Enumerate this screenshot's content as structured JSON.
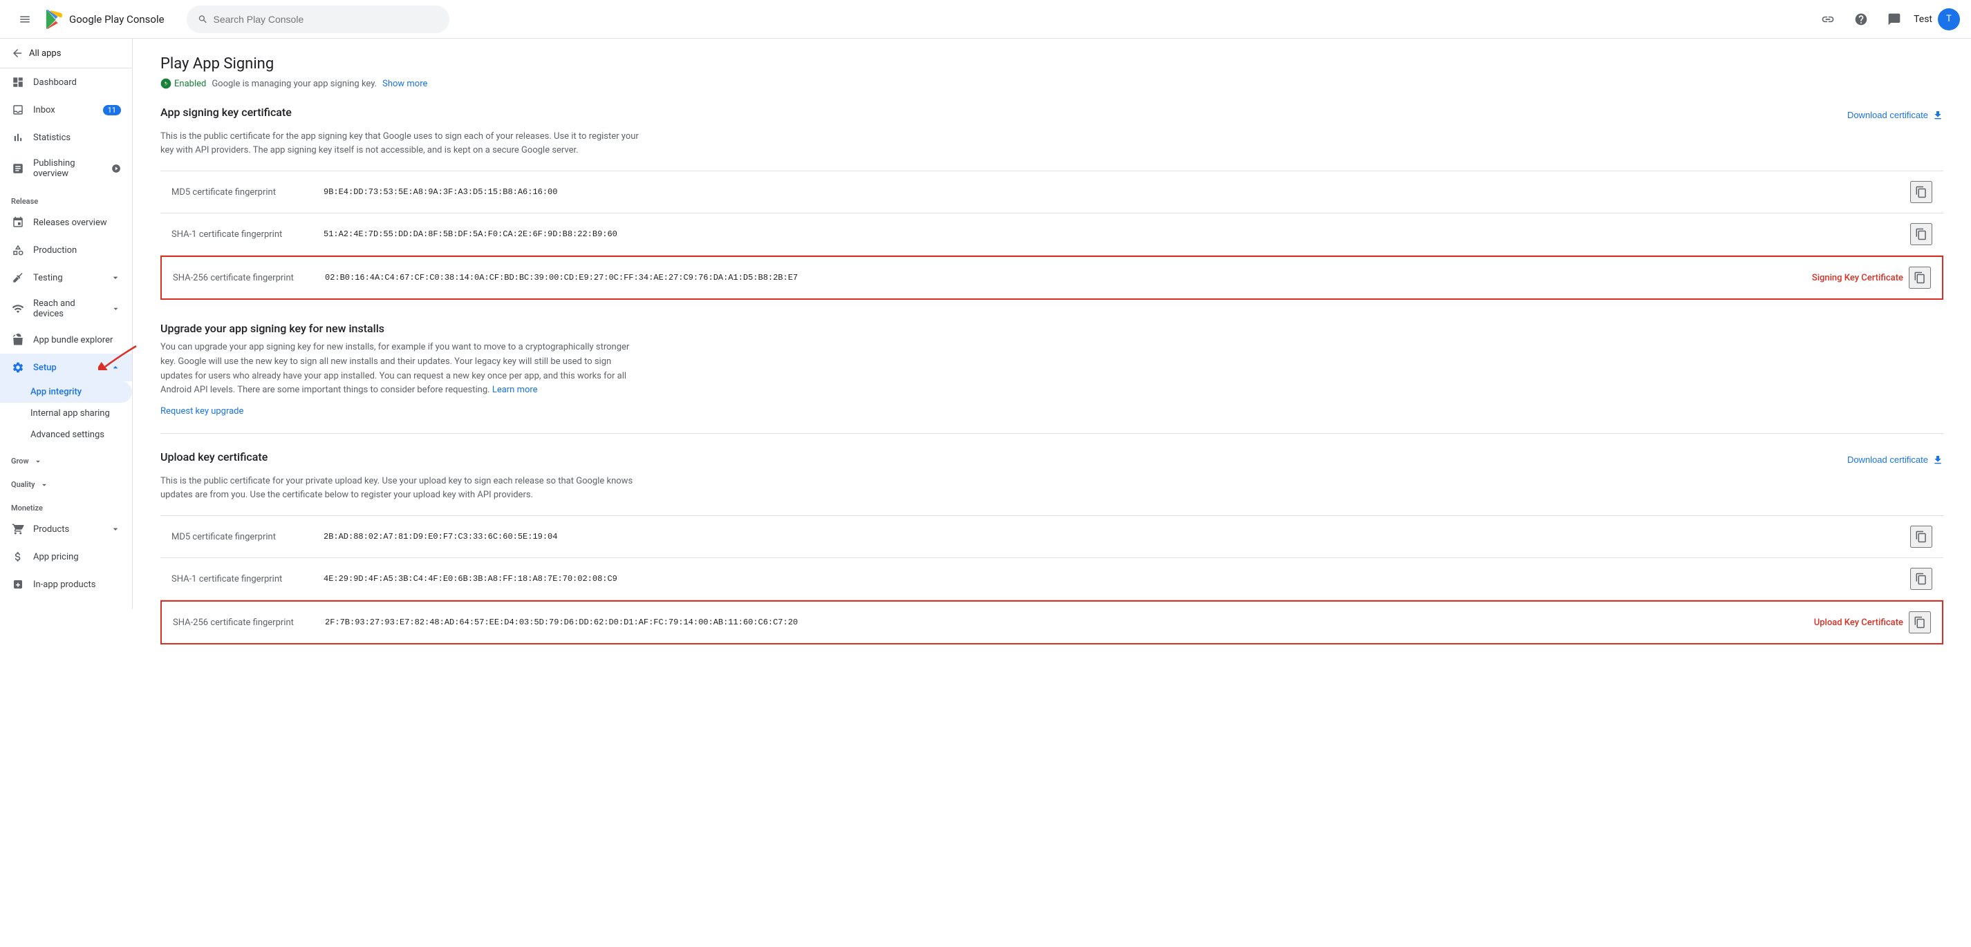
{
  "header": {
    "menu_label": "Menu",
    "logo_text": "Google Play Console",
    "search_placeholder": "Search Play Console",
    "help_label": "Help",
    "messages_label": "Messages",
    "link_label": "Link",
    "user_name": "Test"
  },
  "sidebar": {
    "all_apps_label": "All apps",
    "nav_items": [
      {
        "id": "dashboard",
        "label": "Dashboard",
        "icon": "dashboard"
      },
      {
        "id": "inbox",
        "label": "Inbox",
        "icon": "inbox",
        "badge": "11"
      },
      {
        "id": "statistics",
        "label": "Statistics",
        "icon": "statistics"
      },
      {
        "id": "publishing_overview",
        "label": "Publishing overview",
        "icon": "publishing"
      }
    ],
    "release_section": "Release",
    "release_items": [
      {
        "id": "releases_overview",
        "label": "Releases overview",
        "icon": "releases"
      },
      {
        "id": "production",
        "label": "Production",
        "icon": "production"
      },
      {
        "id": "testing",
        "label": "Testing",
        "icon": "testing",
        "expandable": true
      },
      {
        "id": "reach_devices",
        "label": "Reach and devices",
        "icon": "reach",
        "expandable": true
      },
      {
        "id": "app_bundle",
        "label": "App bundle explorer",
        "icon": "bundle"
      },
      {
        "id": "setup",
        "label": "Setup",
        "icon": "setup",
        "expandable": true,
        "active": true
      }
    ],
    "setup_sub_items": [
      {
        "id": "app_integrity",
        "label": "App integrity",
        "active": true
      },
      {
        "id": "internal_sharing",
        "label": "Internal app sharing"
      },
      {
        "id": "advanced_settings",
        "label": "Advanced settings"
      }
    ],
    "grow_section": "Grow",
    "quality_section": "Quality",
    "monetize_section": "Monetize",
    "monetize_items": [
      {
        "id": "products",
        "label": "Products",
        "expandable": true
      },
      {
        "id": "app_pricing",
        "label": "App pricing"
      },
      {
        "id": "in_app_products",
        "label": "In-app products"
      }
    ]
  },
  "page": {
    "title": "Play App Signing",
    "status_label": "Enabled",
    "status_description": "Google is managing your app signing key.",
    "show_more_label": "Show more",
    "app_signing_key_section": {
      "title": "App signing key certificate",
      "description": "This is the public certificate for the app signing key that Google uses to sign each of your releases. Use it to register your key with API providers. The app signing key itself is not accessible, and is kept on a secure Google server.",
      "download_label": "Download certificate",
      "rows": [
        {
          "label": "MD5 certificate fingerprint",
          "value": "9B:E4:DD:73:53:5E:A8:9A:3F:A3:D5:15:B8:A6:16:00",
          "highlighted": false
        },
        {
          "label": "SHA-1 certificate fingerprint",
          "value": "51:A2:4E:7D:55:DD:DA:8F:5B:DF:5A:F0:CA:2E:6F:9D:B8:22:B9:60",
          "highlighted": false
        },
        {
          "label": "SHA-256 certificate fingerprint",
          "value": "02:B0:16:4A:C4:67:CF:C0:38:14:0A:CF:BD:BC:39:00:CD:E9:27:0C:FF:34:AE:27:C9:76:DA:A1:D5:B8:2B:E7",
          "highlighted": true,
          "highlight_label": "Signing Key Certificate"
        }
      ]
    },
    "upgrade_section": {
      "title": "Upgrade your app signing key for new installs",
      "description": "You can upgrade your app signing key for new installs, for example if you want to move to a cryptographically stronger key. Google will use the new key to sign all new installs and their updates. Your legacy key will still be used to sign updates for users who already have your app installed. You can request a new key once per app, and this works for all Android API levels. There are some important things to consider before requesting.",
      "learn_more_label": "Learn more",
      "request_upgrade_label": "Request key upgrade"
    },
    "upload_key_section": {
      "title": "Upload key certificate",
      "description": "This is the public certificate for your private upload key. Use your upload key to sign each release so that Google knows updates are from you. Use the certificate below to register your upload key with API providers.",
      "download_label": "Download certificate",
      "rows": [
        {
          "label": "MD5 certificate fingerprint",
          "value": "2B:AD:88:02:A7:81:D9:E0:F7:C3:33:6C:60:5E:19:04",
          "highlighted": false
        },
        {
          "label": "SHA-1 certificate fingerprint",
          "value": "4E:29:9D:4F:A5:3B:C4:4F:E0:6B:3B:A8:FF:18:A8:7E:70:02:08:C9",
          "highlighted": false
        },
        {
          "label": "SHA-256 certificate fingerprint",
          "value": "2F:7B:93:27:93:E7:82:48:AD:64:57:EE:D4:03:5D:79:D6:DD:62:D0:D1:AF:FC:79:14:00:AB:11:60:C6:C7:20",
          "highlighted": true,
          "highlight_label": "Upload Key Certificate"
        }
      ]
    }
  }
}
